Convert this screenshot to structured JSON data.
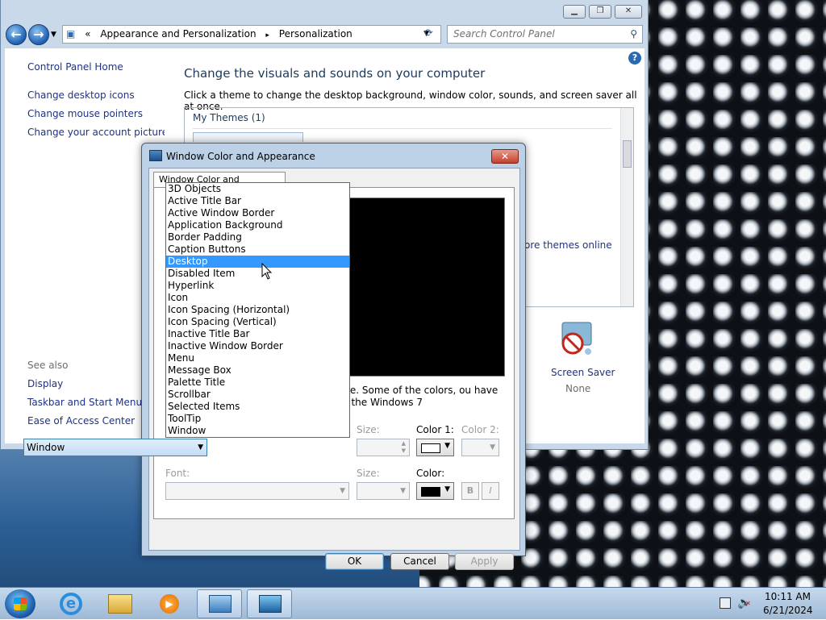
{
  "control_panel": {
    "breadcrumb": [
      "«",
      "Appearance and Personalization",
      "▸",
      "Personalization"
    ],
    "search_placeholder": "Search Control Panel",
    "left_links": [
      "Control Panel Home",
      "Change desktop icons",
      "Change mouse pointers",
      "Change your account picture"
    ],
    "see_also_label": "See also",
    "see_also_links": [
      "Display",
      "Taskbar and Start Menu",
      "Ease of Access Center"
    ],
    "heading": "Change the visuals and sounds on your computer",
    "subheading": "Click a theme to change the desktop background, window color, sounds, and screen saver all at once.",
    "my_themes": "My Themes (1)",
    "themes_online": "ore themes online",
    "screen_saver_label": "Screen Saver",
    "screen_saver_value": "None"
  },
  "dialog": {
    "title": "Window Color and Appearance",
    "tab": "Window Color and Appearance",
    "body_text": "s 7 theme.  Some of the colors, ou have selected the Windows 7",
    "item_value": "Window",
    "size_label": "Size:",
    "color1_label": "Color 1:",
    "color2_label": "Color 2:",
    "font_label": "Font:",
    "size2_label": "Size:",
    "color_label": "Color:",
    "bold_label": "B",
    "italic_label": "I",
    "ok": "OK",
    "cancel": "Cancel",
    "apply": "Apply",
    "colors": {
      "color1": "#ffffff",
      "color": "#000000"
    }
  },
  "dropdown_items": [
    "3D Objects",
    "Active Title Bar",
    "Active Window Border",
    "Application Background",
    "Border Padding",
    "Caption Buttons",
    "Desktop",
    "Disabled Item",
    "Hyperlink",
    "Icon",
    "Icon Spacing (Horizontal)",
    "Icon Spacing (Vertical)",
    "Inactive Title Bar",
    "Inactive Window Border",
    "Menu",
    "Message Box",
    "Palette Title",
    "Scrollbar",
    "Selected Items",
    "ToolTip",
    "Window"
  ],
  "dropdown_selected_index": 6,
  "taskbar": {
    "time": "10:11 AM",
    "date": "6/21/2024"
  }
}
